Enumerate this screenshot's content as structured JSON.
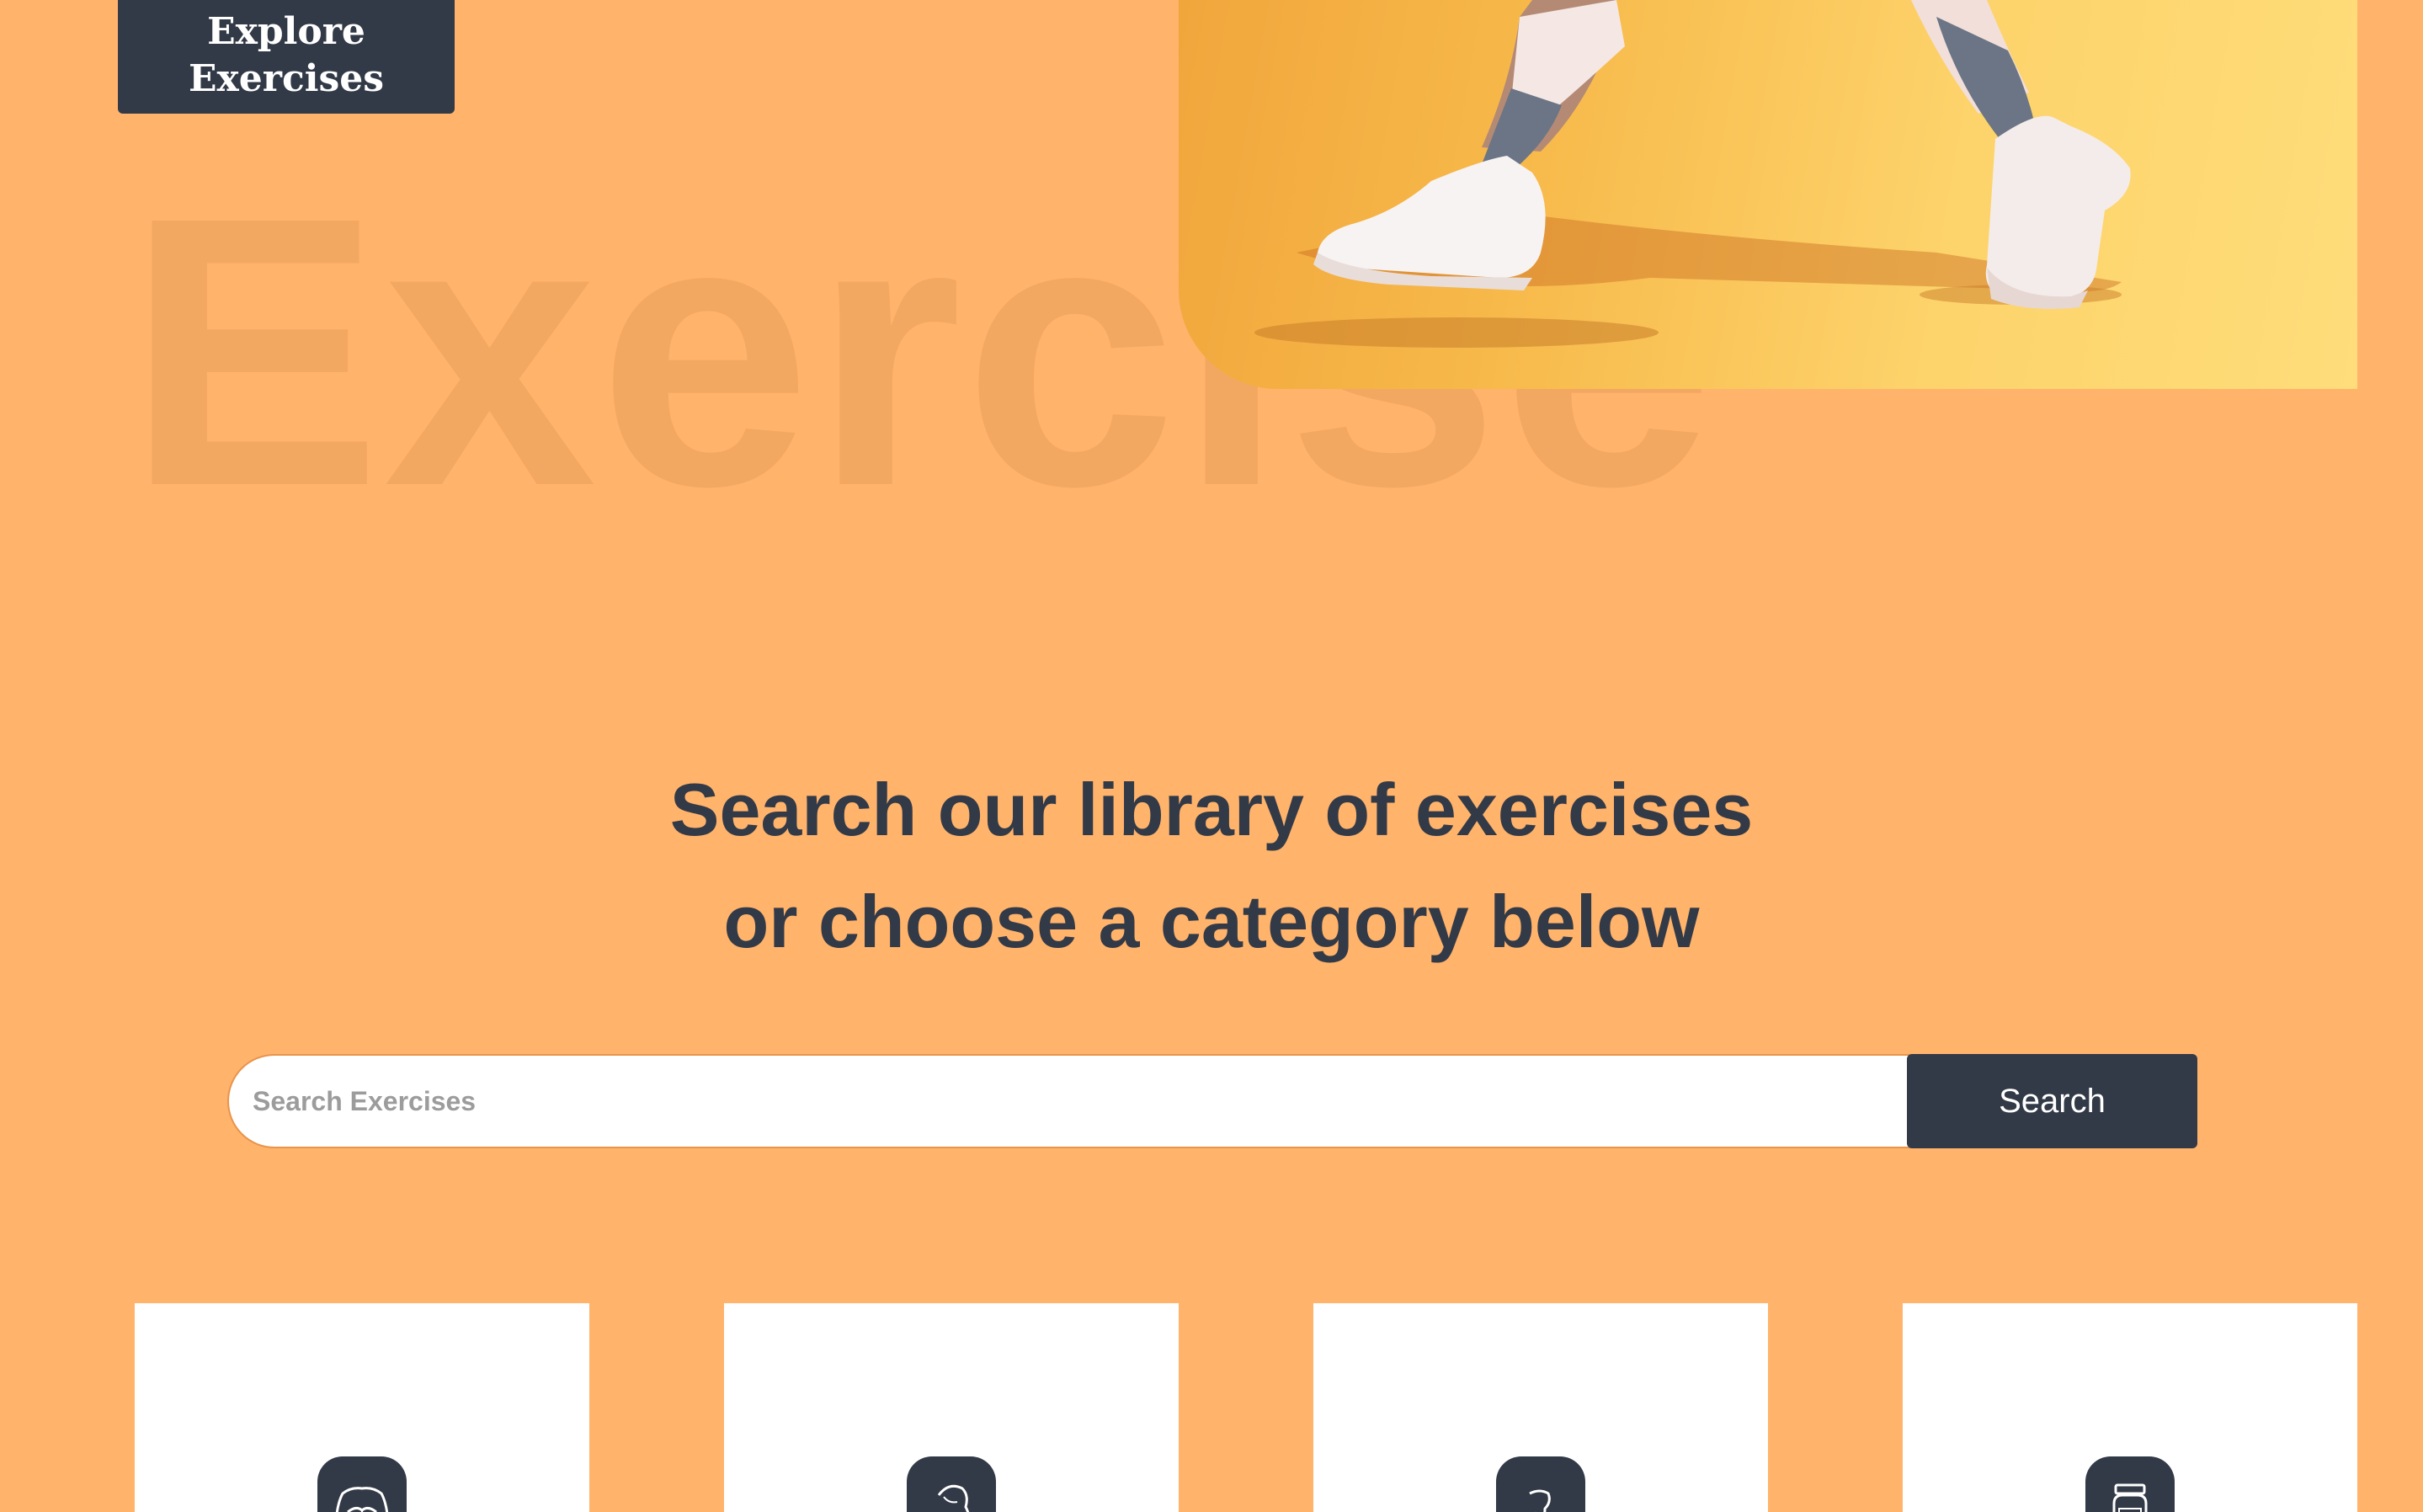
{
  "header": {
    "explore_line1": "Explore",
    "explore_line2": "Exercises"
  },
  "hero": {
    "background_word": "Exercise"
  },
  "main": {
    "heading_line1": "Search our library of exercises",
    "heading_line2": "or choose a category below"
  },
  "search": {
    "placeholder": "Search Exercises",
    "button_label": "Search"
  },
  "categories": [
    {
      "icon": "torso-icon"
    },
    {
      "icon": "bicep-arm-icon"
    },
    {
      "icon": "leg-icon"
    },
    {
      "icon": "protein-jar-icon"
    }
  ],
  "colors": {
    "background": "#FFB36B",
    "dark": "#333A47",
    "white": "#FFFFFF"
  }
}
